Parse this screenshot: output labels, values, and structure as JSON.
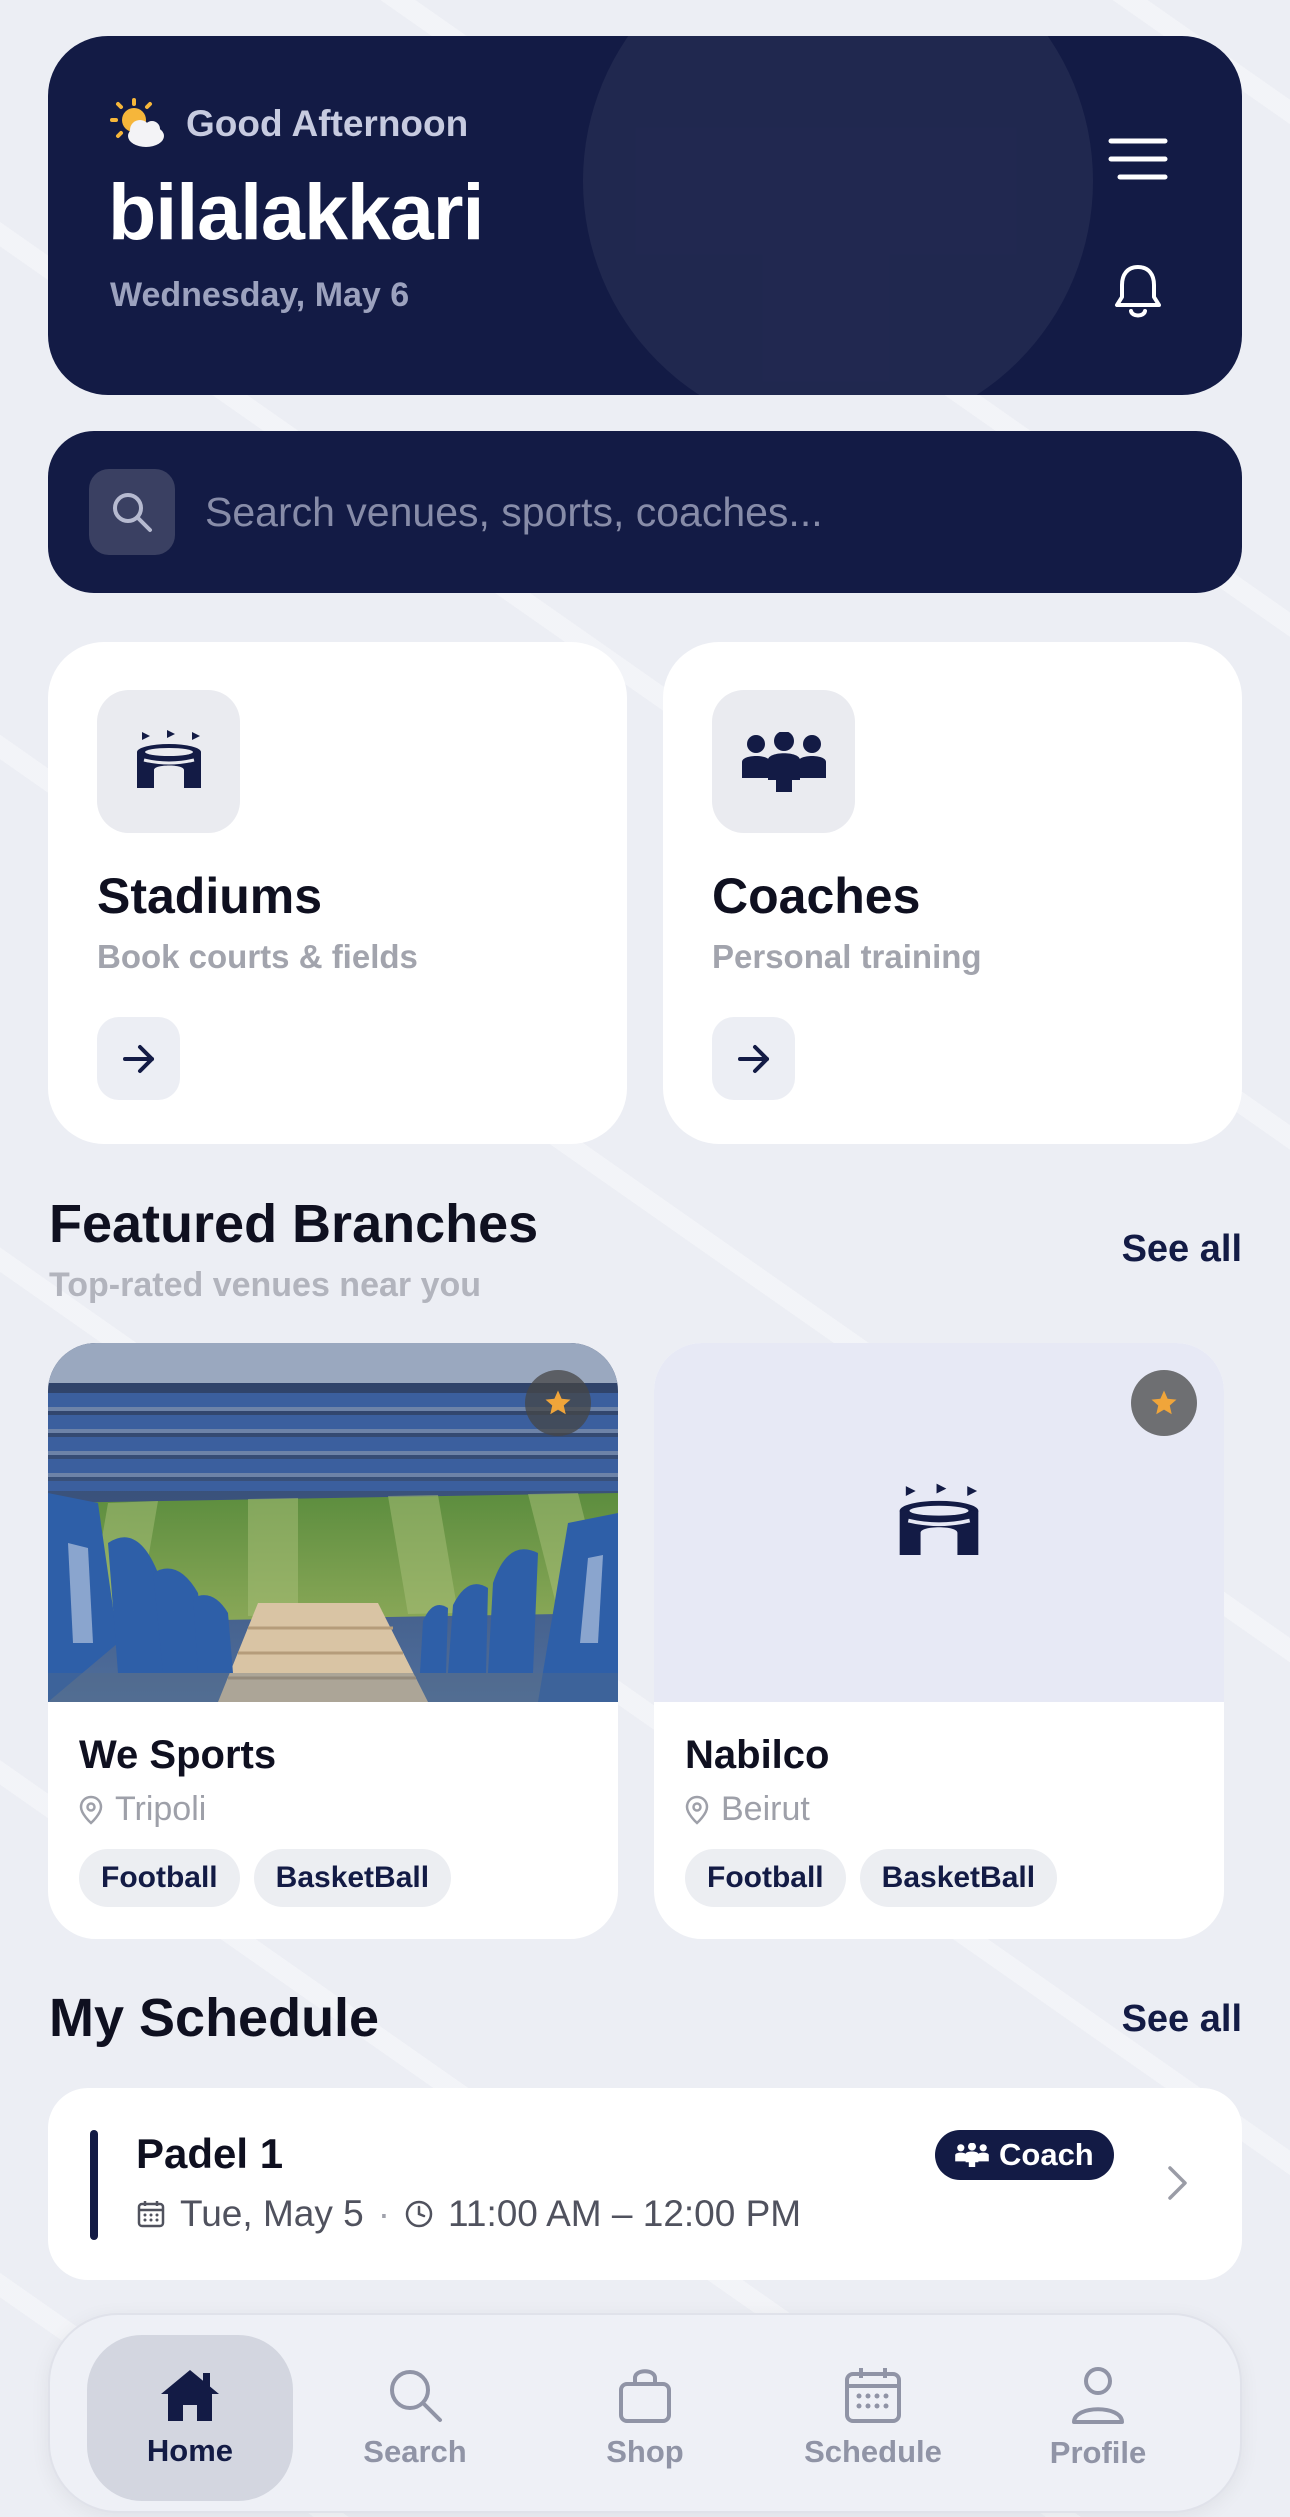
{
  "header": {
    "greeting": "Good Afternoon",
    "username": "bilalakkari",
    "date": "Wednesday, May 6",
    "icons": [
      "weather-sun-cloud-icon",
      "menu-icon",
      "bell-icon"
    ]
  },
  "search": {
    "placeholder": "Search venues, sports, coaches..."
  },
  "categories": [
    {
      "title": "Stadiums",
      "subtitle": "Book courts & fields",
      "icon": "stadium-icon"
    },
    {
      "title": "Coaches",
      "subtitle": "Personal training",
      "icon": "people-group-icon"
    }
  ],
  "featured": {
    "title": "Featured Branches",
    "subtitle": "Top-rated venues near you",
    "see_all": "See all",
    "branches": [
      {
        "name": "We Sports",
        "location": "Tripoli",
        "tags": [
          "Football",
          "BasketBall"
        ],
        "image": "stadium-photo"
      },
      {
        "name": "Nabilco",
        "location": "Beirut",
        "tags": [
          "Football",
          "BasketBall"
        ],
        "image": "stadium-placeholder"
      }
    ]
  },
  "schedule": {
    "title": "My Schedule",
    "see_all": "See all",
    "items": [
      {
        "title": "Padel 1",
        "date": "Tue, May 5",
        "separator": "·",
        "time": "11:00 AM – 12:00 PM",
        "badge": "Coach"
      }
    ]
  },
  "tabs": [
    {
      "label": "Home",
      "icon": "home-icon",
      "active": true
    },
    {
      "label": "Search",
      "icon": "search-icon",
      "active": false
    },
    {
      "label": "Shop",
      "icon": "shopping-bag-icon",
      "active": false
    },
    {
      "label": "Schedule",
      "icon": "calendar-icon",
      "active": false
    },
    {
      "label": "Profile",
      "icon": "person-icon",
      "active": false
    }
  ],
  "colors": {
    "navy": "#131b45",
    "background": "#eceef4",
    "star": "#f0a53a"
  }
}
